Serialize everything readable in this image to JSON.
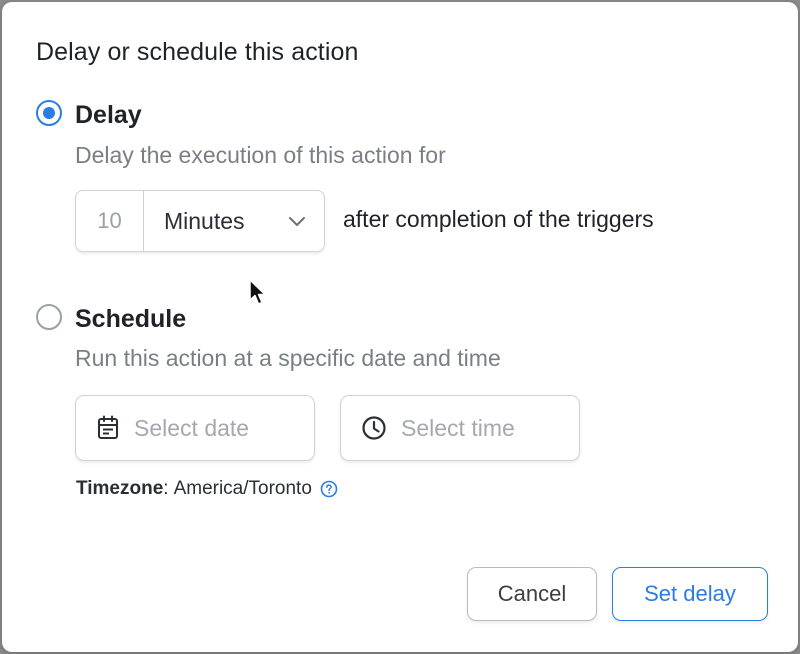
{
  "dialog": {
    "title": "Delay or schedule this action",
    "delay_option": {
      "label": "Delay",
      "description": "Delay the execution of this action for",
      "selected": true,
      "amount": "10",
      "unit": "Minutes",
      "suffix": "after completion of the triggers"
    },
    "schedule_option": {
      "label": "Schedule",
      "description": "Run this action at a specific date and time",
      "selected": false,
      "date_placeholder": "Select date",
      "time_placeholder": "Select time",
      "date_icon": "calendar-icon",
      "time_icon": "clock-icon"
    },
    "timezone": {
      "label": "Timezone",
      "separator": ":",
      "value": "America/Toronto",
      "help_icon": "help-circle-icon"
    },
    "buttons": {
      "cancel": "Cancel",
      "confirm": "Set delay"
    }
  },
  "colors": {
    "accent": "#2a7de1",
    "text": "#1f2328",
    "muted": "#7a7f85",
    "border": "#cfd3d7"
  }
}
